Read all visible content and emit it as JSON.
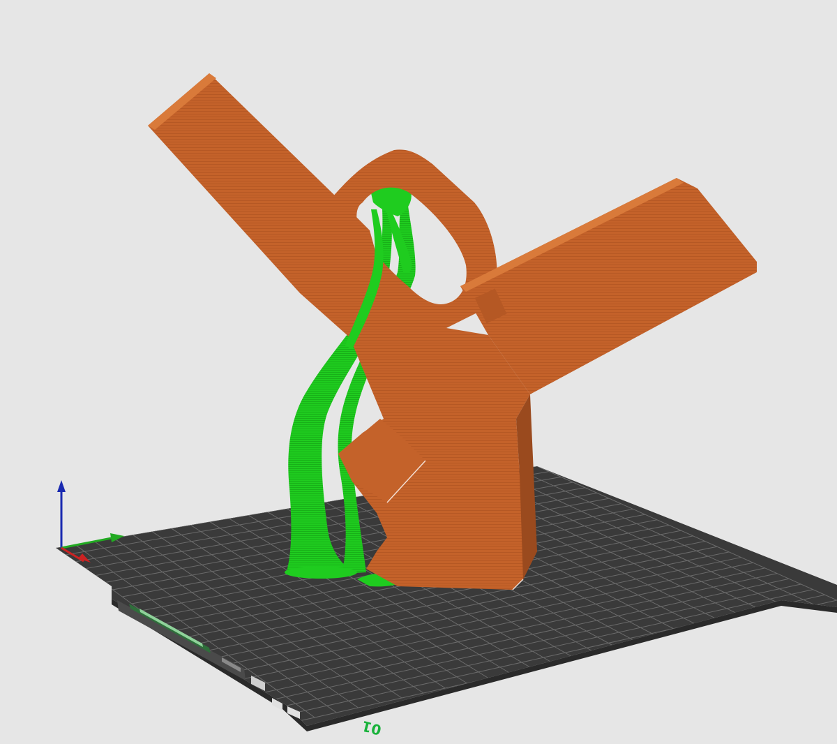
{
  "viewport": {
    "background": "#e6e6e6"
  },
  "bed": {
    "surface_color": "#3a3a3a",
    "grid_color": "#6b6b6b",
    "label_text": "01",
    "label_color": "#19b23b"
  },
  "model": {
    "color": "#c4622a",
    "shadow_color": "#9a4a1e",
    "highlight_color": "#d97a3a"
  },
  "supports": {
    "color": "#1fcc1f",
    "dark_color": "#12a012"
  },
  "axes": {
    "x_color": "#cc2222",
    "y_color": "#22aa22",
    "z_color": "#1a2ab0"
  }
}
